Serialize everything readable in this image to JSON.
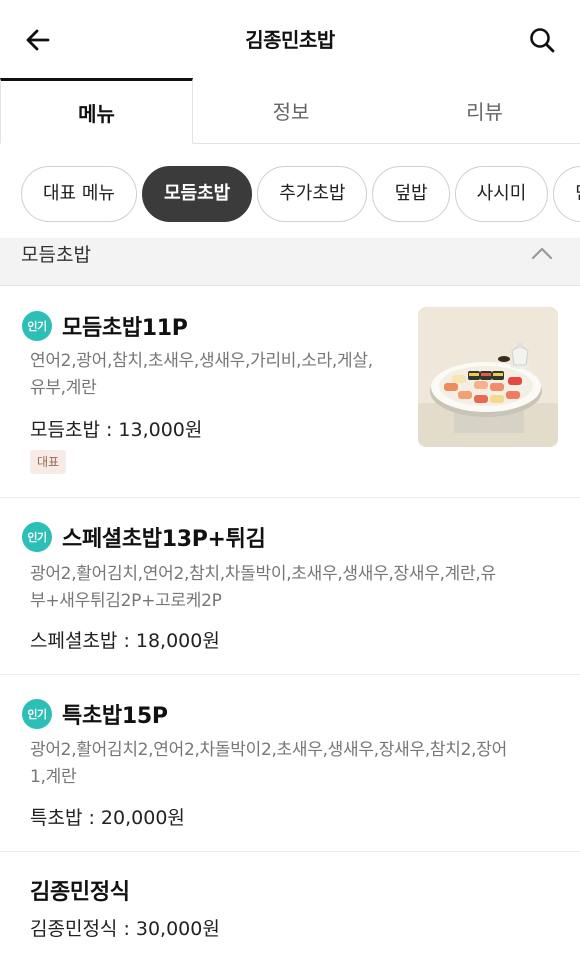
{
  "header": {
    "title": "김종민초밥",
    "back_icon": "arrow-left-icon",
    "search_icon": "search-icon"
  },
  "tabs": [
    {
      "label": "메뉴",
      "active": true
    },
    {
      "label": "정보",
      "active": false
    },
    {
      "label": "리뷰",
      "active": false
    }
  ],
  "categories": [
    {
      "label": "대표 메뉴",
      "selected": false
    },
    {
      "label": "모듬초밥",
      "selected": true
    },
    {
      "label": "추가초밥",
      "selected": false
    },
    {
      "label": "덮밥",
      "selected": false
    },
    {
      "label": "사시미",
      "selected": false
    },
    {
      "label": "단품",
      "selected": false
    }
  ],
  "section": {
    "title": "모듬초밥",
    "toggle_icon": "chevron-up-icon"
  },
  "items": [
    {
      "badge": "인기",
      "name": "모듬초밥11P",
      "description_lines": [
        "연어2,광어,참치,초새우,생새우,가리비,소라,게살,",
        "유부,계란"
      ],
      "price": "모듬초밥 : 13,000원",
      "tag": "대표",
      "has_image": true
    },
    {
      "badge": "인기",
      "name": "스페셜초밥13P+튀김",
      "description_lines": [
        "광어2,활어김치,연어2,참치,차돌박이,초새우,생새우,장새우,계란,유",
        "부+새우튀김2P+고로케2P"
      ],
      "price": "스페셜초밥 : 18,000원"
    },
    {
      "badge": "인기",
      "name": "특초밥15P",
      "description_lines": [
        "광어2,활어김치2,연어2,차돌박이2,초새우,생새우,장새우,참치2,장어",
        "1,계란"
      ],
      "price": "특초밥 : 20,000원"
    },
    {
      "name": "김종민정식",
      "price": "김종민정식 : 30,000원"
    }
  ],
  "colors": {
    "popular_badge": "#2bbfb6",
    "selected_chip": "#3b3b3b",
    "rep_tag_bg": "#f6ebe6",
    "rep_tag_text": "#9a6a55"
  }
}
